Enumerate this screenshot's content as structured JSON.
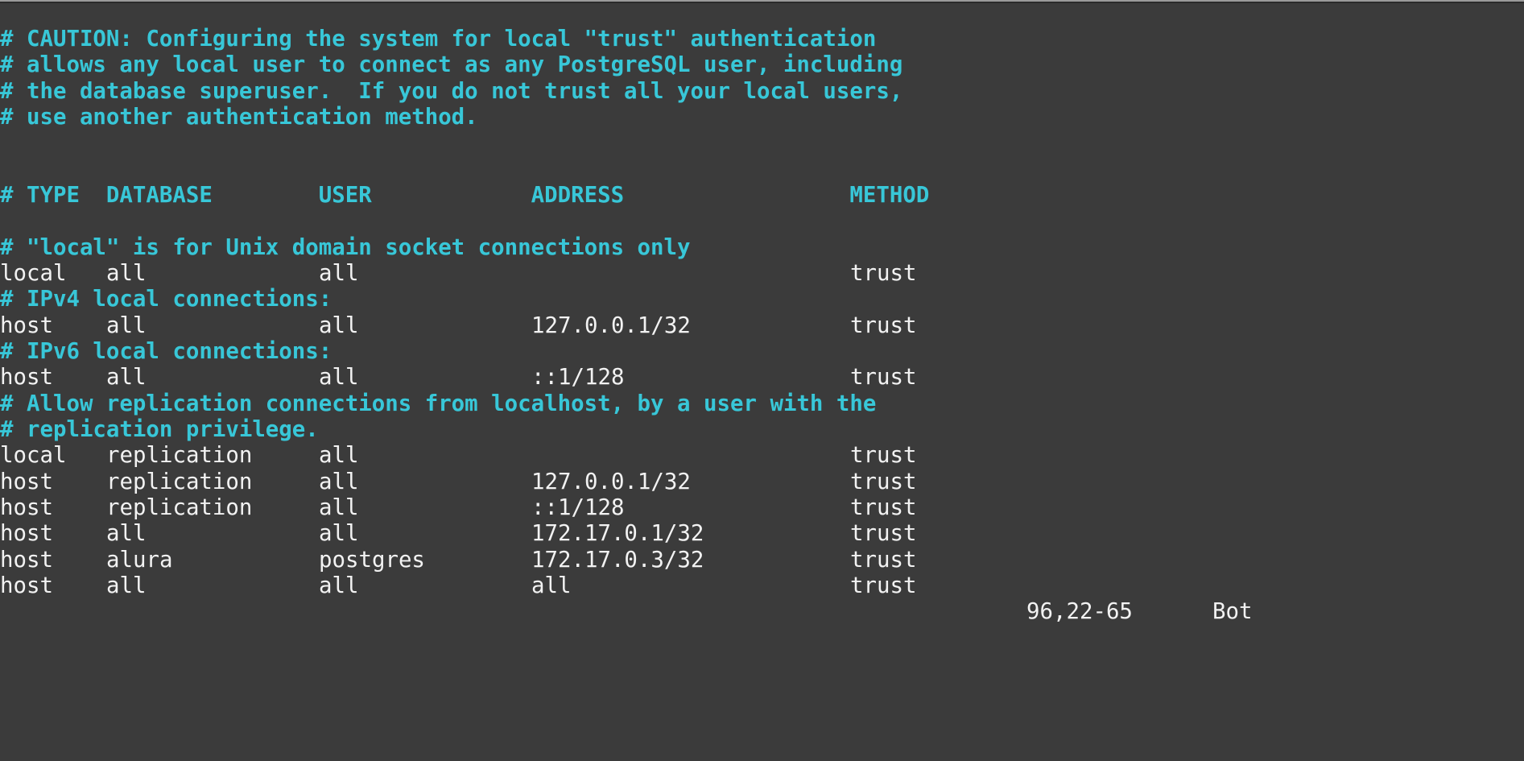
{
  "editor": {
    "lines": [
      {
        "kind": "blank"
      },
      {
        "kind": "comment",
        "text": "# CAUTION: Configuring the system for local \"trust\" authentication"
      },
      {
        "kind": "comment",
        "text": "# allows any local user to connect as any PostgreSQL user, including"
      },
      {
        "kind": "comment",
        "text": "# the database superuser.  If you do not trust all your local users,"
      },
      {
        "kind": "comment",
        "text": "# use another authentication method."
      },
      {
        "kind": "blank"
      },
      {
        "kind": "blank"
      },
      {
        "kind": "comment",
        "text": "# TYPE  DATABASE        USER            ADDRESS                 METHOD"
      },
      {
        "kind": "blank"
      },
      {
        "kind": "comment",
        "text": "# \"local\" is for Unix domain socket connections only"
      },
      {
        "kind": "entry",
        "cols": [
          "local",
          "all",
          "all",
          "",
          "trust"
        ]
      },
      {
        "kind": "comment",
        "text": "# IPv4 local connections:"
      },
      {
        "kind": "entry",
        "cols": [
          "host",
          "all",
          "all",
          "127.0.0.1/32",
          "trust"
        ]
      },
      {
        "kind": "comment",
        "text": "# IPv6 local connections:"
      },
      {
        "kind": "entry",
        "cols": [
          "host",
          "all",
          "all",
          "::1/128",
          "trust"
        ]
      },
      {
        "kind": "comment",
        "text": "# Allow replication connections from localhost, by a user with the"
      },
      {
        "kind": "comment",
        "text": "# replication privilege."
      },
      {
        "kind": "entry",
        "cols": [
          "local",
          "replication",
          "all",
          "",
          "trust"
        ]
      },
      {
        "kind": "entry",
        "cols": [
          "host",
          "replication",
          "all",
          "127.0.0.1/32",
          "trust"
        ]
      },
      {
        "kind": "entry",
        "cols": [
          "host",
          "replication",
          "all",
          "::1/128",
          "trust"
        ]
      },
      {
        "kind": "entry",
        "cols": [
          "host",
          "all",
          "all",
          "172.17.0.1/32",
          "trust"
        ]
      },
      {
        "kind": "entry",
        "cols": [
          "host",
          "alura",
          "postgres",
          "172.17.0.3/32",
          "trust"
        ]
      },
      {
        "kind": "entry",
        "cols": [
          "host",
          "all",
          "all",
          "all",
          "trust"
        ]
      }
    ]
  },
  "status": {
    "position": "96,22-65",
    "scroll": "Bot"
  },
  "colors": {
    "background": "#3b3b3b",
    "comment": "#38c7d8",
    "text": "#f2f2f2"
  }
}
